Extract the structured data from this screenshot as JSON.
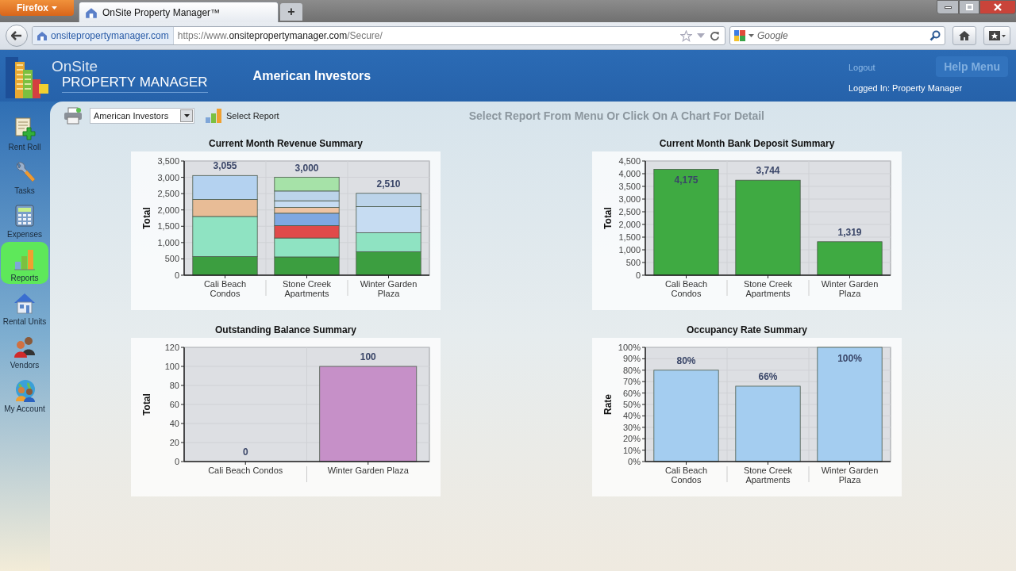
{
  "browser": {
    "menu_button": "Firefox",
    "tabs": [
      {
        "title": "OnSite Property Manager™",
        "selected": true
      }
    ],
    "new_tab": "+",
    "site_identity": "onsitepropertymanager.com",
    "url": {
      "prefix": "https://www.",
      "domain": "onsitepropertymanager.com",
      "path": "/Secure/"
    },
    "search": {
      "placeholder": "Google"
    }
  },
  "header": {
    "logo": {
      "line_1": "OnSite",
      "line_2": "PROPERTY MANAGER"
    },
    "title": "American Investors",
    "logout": "Logout",
    "help_button": "Help Menu",
    "logged_in": "Logged In: Property Manager"
  },
  "sidebar": {
    "items": [
      {
        "label": "Rent Roll",
        "selected": false
      },
      {
        "label": "Tasks",
        "selected": false
      },
      {
        "label": "Expenses",
        "selected": false
      },
      {
        "label": "Reports",
        "selected": true
      },
      {
        "label": "Rental Units",
        "selected": false
      },
      {
        "label": "Vendors",
        "selected": false
      },
      {
        "label": "My Account",
        "selected": false
      }
    ]
  },
  "toolbar": {
    "portfolio_select": "American Investors",
    "select_report": "Select Report",
    "instruction": "Select Report From Menu Or Click On A Chart For Detail"
  },
  "charts": [
    {
      "chart_data": {
        "type": "bar",
        "grid": true,
        "stacked": true,
        "title": "Current Month Revenue Summary",
        "ylabel": "Total",
        "categories": [
          "Cali Beach Condos",
          "Stone Creek Apartments",
          "Winter Garden Plaza"
        ],
        "ylim": [
          0,
          3500
        ],
        "yticks": [
          0,
          500,
          {
            "value": 1000,
            "label": "1,000"
          },
          {
            "value": 1500,
            "label": "1,500"
          },
          {
            "value": 2000,
            "label": "2,000"
          },
          {
            "value": 2500,
            "label": "2,500"
          },
          {
            "value": 3000,
            "label": "3,000"
          },
          {
            "value": 3500,
            "label": "3,500"
          }
        ],
        "series": [
          {
            "color": "#3c9e40",
            "values": [
              570,
              560,
              720
            ]
          },
          {
            "color": "#8fe3c2",
            "values": [
              1230,
              580,
              580
            ]
          },
          {
            "color": "#e8bc96",
            "values": [
              520,
              null,
              null
            ]
          },
          {
            "color": "#b4d2f0",
            "values": [
              735,
              null,
              null
            ]
          },
          {
            "color": "#e04a4a",
            "values": [
              null,
              380,
              null
            ]
          },
          {
            "color": "#7fa8e2",
            "values": [
              null,
              380,
              null
            ]
          },
          {
            "color": "#eec4a4",
            "values": [
              null,
              180,
              null
            ]
          },
          {
            "color": "#c6dcf2",
            "values": [
              null,
              200,
              800
            ]
          },
          {
            "color": "#bcd4ea",
            "values": [
              null,
              300,
              410
            ]
          },
          {
            "color": "#a6e2a8",
            "values": [
              null,
              420,
              null
            ]
          }
        ],
        "value_labels": [
          "3,055",
          "3,000",
          "2,510"
        ]
      }
    },
    {
      "chart_data": {
        "type": "bar",
        "grid": true,
        "title": "Current Month Bank Deposit Summary",
        "ylabel": "Total",
        "categories": [
          "Cali Beach Condos",
          "Stone Creek Apartments",
          "Winter Garden Plaza"
        ],
        "ylim": [
          0,
          4500
        ],
        "yticks": [
          0,
          500,
          {
            "value": 1000,
            "label": "1,000"
          },
          {
            "value": 1500,
            "label": "1,500"
          },
          {
            "value": 2000,
            "label": "2,000"
          },
          {
            "value": 2500,
            "label": "2,500"
          },
          {
            "value": 3000,
            "label": "3,000"
          },
          {
            "value": 3500,
            "label": "3,500"
          },
          {
            "value": 4000,
            "label": "4,000"
          },
          {
            "value": 4500,
            "label": "4,500"
          }
        ],
        "series": [
          {
            "color": "#3faa42",
            "values": [
              4175,
              3744,
              1319
            ]
          }
        ],
        "value_labels": [
          "4,175",
          "3,744",
          "1,319"
        ]
      }
    },
    {
      "chart_data": {
        "type": "bar",
        "grid": true,
        "title": "Outstanding Balance Summary",
        "ylabel": "Total",
        "categories": [
          "Cali Beach Condos",
          "Winter Garden Plaza"
        ],
        "ylim": [
          0,
          120
        ],
        "yticks": [
          0,
          20,
          40,
          60,
          80,
          100,
          120
        ],
        "series": [
          {
            "color": "#c690c8",
            "values": [
              0,
              100
            ]
          }
        ],
        "value_labels": [
          "0",
          "100"
        ]
      }
    },
    {
      "chart_data": {
        "type": "bar",
        "grid": true,
        "title": "Occupancy Rate Summary",
        "ylabel": "Rate",
        "categories": [
          "Cali Beach Condos",
          "Stone Creek Apartments",
          "Winter Garden Plaza"
        ],
        "ylim": [
          0,
          100
        ],
        "yticks": [
          {
            "value": 0,
            "label": "0%"
          },
          {
            "value": 10,
            "label": "10%"
          },
          {
            "value": 20,
            "label": "20%"
          },
          {
            "value": 30,
            "label": "30%"
          },
          {
            "value": 40,
            "label": "40%"
          },
          {
            "value": 50,
            "label": "50%"
          },
          {
            "value": 60,
            "label": "60%"
          },
          {
            "value": 70,
            "label": "70%"
          },
          {
            "value": 80,
            "label": "80%"
          },
          {
            "value": 90,
            "label": "90%"
          },
          {
            "value": 100,
            "label": "100%"
          }
        ],
        "series": [
          {
            "color": "#a4cdf0",
            "values": [
              80,
              66,
              100
            ]
          }
        ],
        "value_labels": [
          "80%",
          "66%",
          "100%"
        ]
      }
    }
  ]
}
